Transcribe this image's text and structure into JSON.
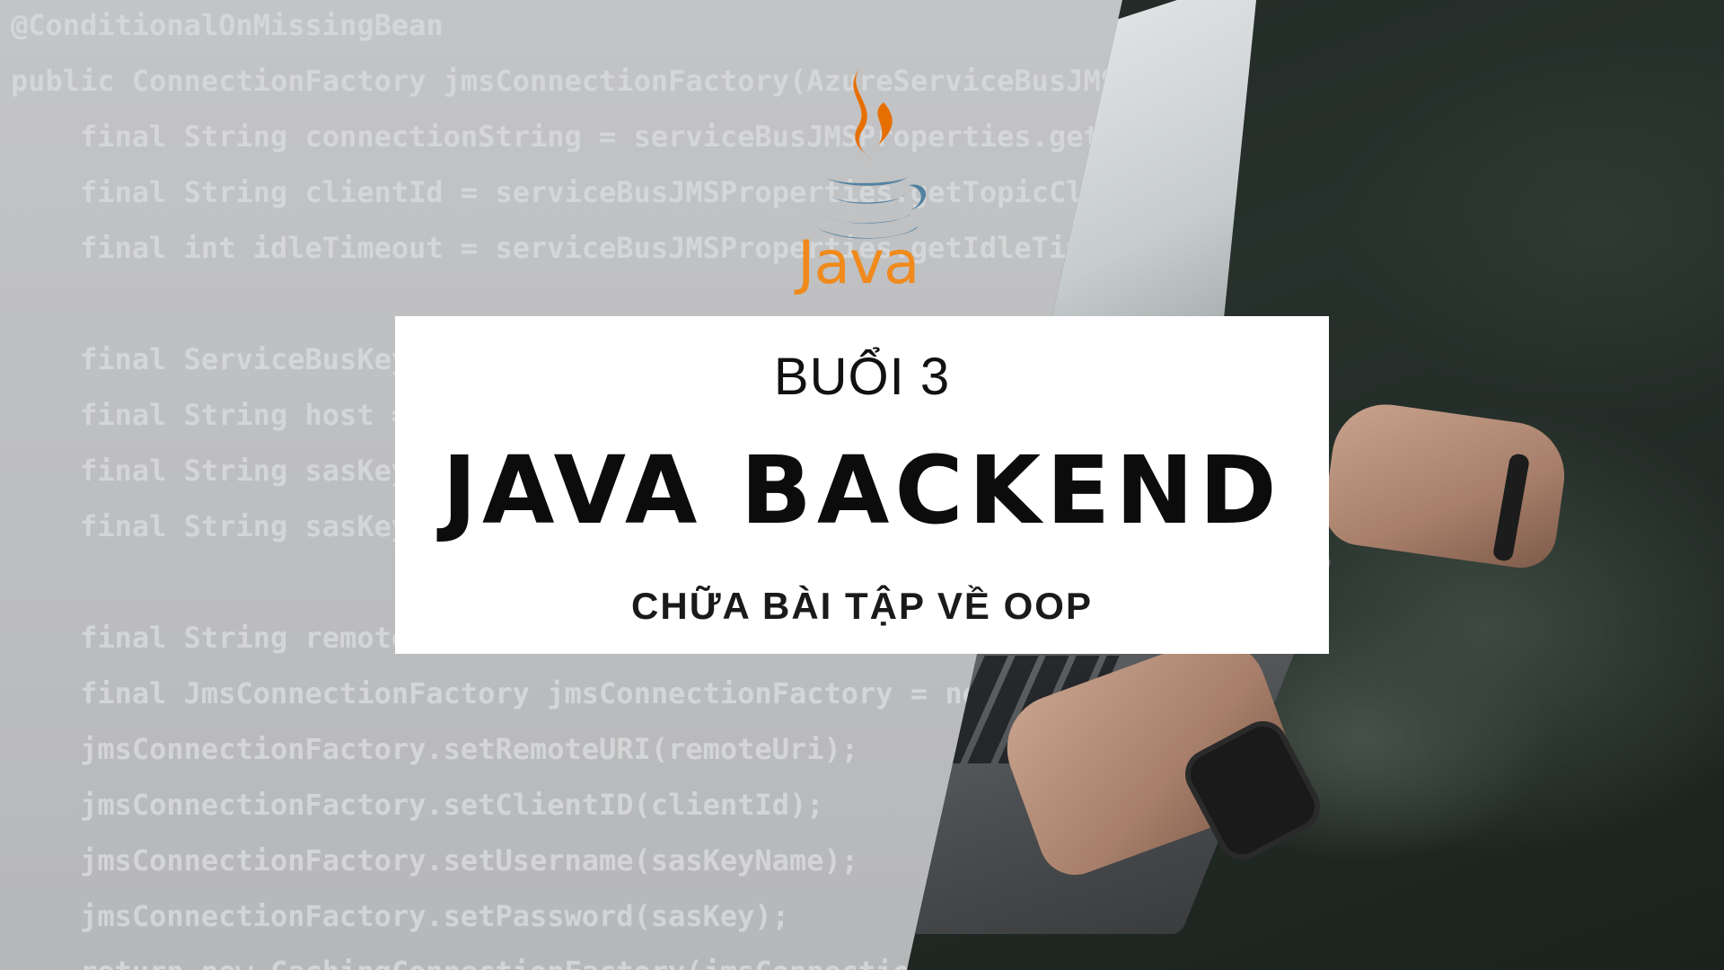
{
  "code_lines": [
    "@ConditionalOnMissingBean",
    "public ConnectionFactory jmsConnectionFactory(AzureServiceBusJMSP",
    "    final String connectionString = serviceBusJMSProperties.getCo",
    "    final String clientId = serviceBusJMSProperties.getTopicCli",
    "    final int idleTimeout = serviceBusJMSProperties.getIdleTime",
    "",
    "    final ServiceBusKey",
    "    final String host =",
    "    final String sasKey",
    "    final String sasKey",
    "",
    "    final String remote",
    "    final JmsConnectionFactory jmsConnectionFactory = new",
    "    jmsConnectionFactory.setRemoteURI(remoteUri);",
    "    jmsConnectionFactory.setClientID(clientId);",
    "    jmsConnectionFactory.setUsername(sasKeyName);",
    "    jmsConnectionFactory.setPassword(sasKey);",
    "    return new CachingConnectionFactory(jmsConnection"
  ],
  "logo": {
    "word": "Java",
    "icon": "java-coffee-cup-icon",
    "color": "#f08a1c",
    "steam_color": "#e76f00",
    "cup_color": "#5382a1"
  },
  "card": {
    "session": "BUỔI 3",
    "title": "JAVA BACKEND",
    "subtitle": "CHỮA BÀI TẬP VỀ OOP"
  }
}
